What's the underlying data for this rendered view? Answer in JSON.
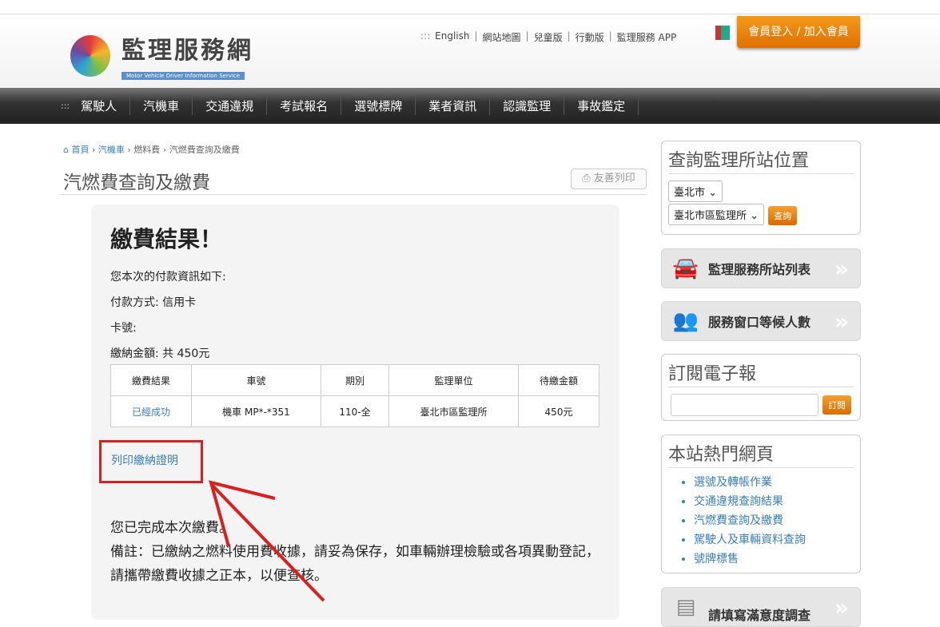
{
  "header": {
    "logo_title": "監理服務網",
    "logo_subtitle": "Motor Vehicle Driver Information Service",
    "top_links": [
      "English",
      "網站地圖",
      "兒童版",
      "行動版",
      "監理服務 APP"
    ],
    "login": "會員登入 / 加入會員"
  },
  "nav": [
    "駕駛人",
    "汽機車",
    "交通違規",
    "考試報名",
    "選號標牌",
    "業者資訊",
    "認識監理",
    "事故鑑定"
  ],
  "breadcrumb": [
    "首頁",
    "汽機車",
    "燃料費",
    "汽燃費查詢及繳費"
  ],
  "page_title": "汽燃費查詢及繳費",
  "print_button": "友善列印",
  "result": {
    "heading": "繳費結果！",
    "intro": "您本次的付款資訊如下:",
    "method": "付款方式: 信用卡",
    "card": "卡號:",
    "amount": "繳納金額: 共 450元",
    "table": {
      "headers": [
        "繳費結果",
        "車號",
        "期別",
        "監理單位",
        "待繳金額"
      ],
      "rows": [
        [
          "已經成功",
          "機車 MP*-*351",
          "110-全",
          "臺北市區監理所",
          "450元"
        ]
      ]
    },
    "print_proof": "列印繳納證明",
    "done": "您已完成本次繳費。",
    "remark": "備註：已繳納之燃料使用費收據，請妥為保存，如車輛辦理檢驗或各項異動登記，請攜帶繳費收據之正本，以便查核。"
  },
  "sidebar": {
    "locate_title": "查詢監理所站位置",
    "city": "臺北市",
    "office": "臺北市區監理所",
    "query": "查詢",
    "station_list": "監理服務所站列表",
    "waiting": "服務窗口等候人數",
    "newsletter_title": "訂閱電子報",
    "newsletter_placeholder": "",
    "subscribe": "訂閱",
    "hot_title": "本站熱門網頁",
    "hot_links": [
      "選號及轉帳作業",
      "交通違規查詢結果",
      "汽燃費查詢及繳費",
      "駕駛人及車輛資料查詢",
      "號牌標售"
    ],
    "survey": "請填寫滿意度調查"
  }
}
